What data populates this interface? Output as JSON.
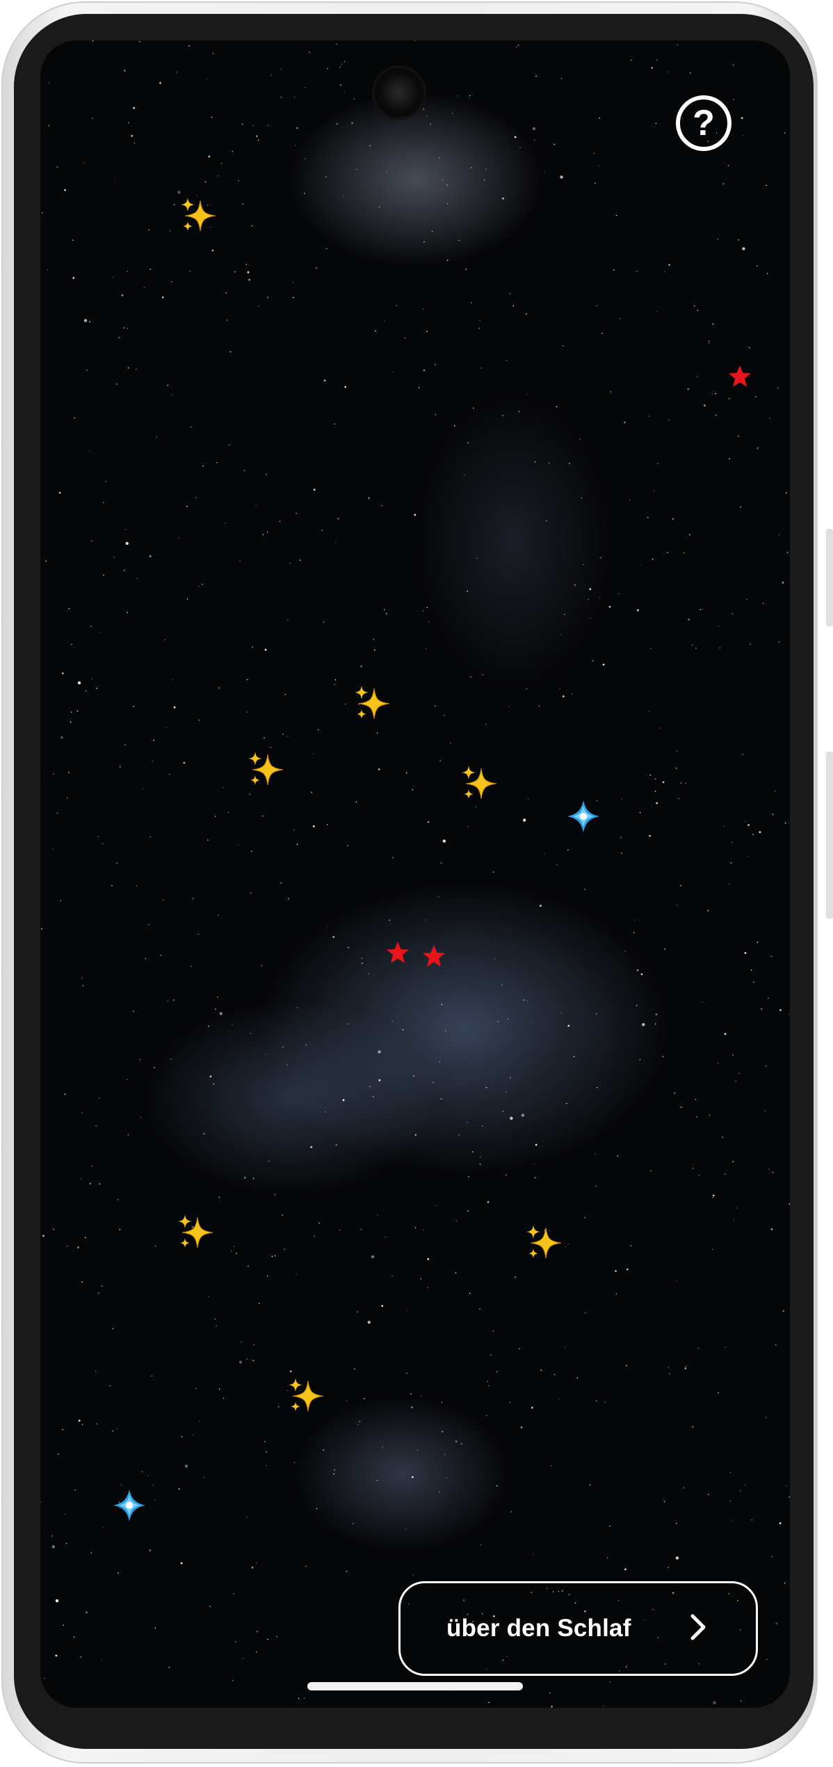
{
  "screen": {
    "background": "night-sky-milky-way",
    "help_button": {
      "icon": "question-mark-icon",
      "glyph": "?"
    },
    "next_button": {
      "label": "über den Schlaf",
      "icon": "chevron-right-icon"
    },
    "stickers": [
      {
        "kind": "sparkles",
        "icon": "sparkles-icon"
      },
      {
        "kind": "red-star",
        "icon": "red-star-icon",
        "color": "#e4161c"
      },
      {
        "kind": "sparkles",
        "icon": "sparkles-icon"
      },
      {
        "kind": "sparkles",
        "icon": "sparkles-icon"
      },
      {
        "kind": "sparkles",
        "icon": "sparkles-icon"
      },
      {
        "kind": "blue-flower",
        "icon": "blue-four-point-star-icon",
        "color": "#2aa4e8"
      },
      {
        "kind": "red-star",
        "icon": "red-star-icon",
        "color": "#e4161c"
      },
      {
        "kind": "red-star",
        "icon": "red-star-icon",
        "color": "#e4161c"
      },
      {
        "kind": "sparkles",
        "icon": "sparkles-icon"
      },
      {
        "kind": "sparkles",
        "icon": "sparkles-icon"
      },
      {
        "kind": "sparkles",
        "icon": "sparkles-icon"
      },
      {
        "kind": "blue-flower",
        "icon": "blue-four-point-star-icon",
        "color": "#2aa4e8"
      }
    ]
  },
  "colors": {
    "sparkle": "#f6c21c",
    "red_star": "#e4161c",
    "blue_star": "#2aa4e8",
    "text": "#ffffff"
  }
}
